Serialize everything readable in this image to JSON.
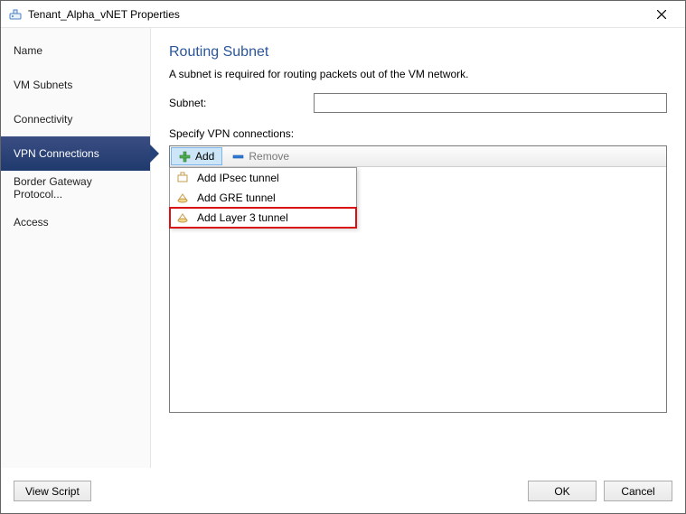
{
  "window": {
    "title": "Tenant_Alpha_vNET Properties"
  },
  "sidebar": {
    "items": [
      {
        "label": "Name",
        "selected": false
      },
      {
        "label": "VM Subnets",
        "selected": false
      },
      {
        "label": "Connectivity",
        "selected": false
      },
      {
        "label": "VPN Connections",
        "selected": true
      },
      {
        "label": "Border Gateway Protocol...",
        "selected": false
      },
      {
        "label": "Access",
        "selected": false
      }
    ]
  },
  "main": {
    "heading": "Routing Subnet",
    "description": "A subnet is required for routing packets out of the VM network.",
    "subnet_label": "Subnet:",
    "subnet_value": "",
    "vpn_label": "Specify VPN connections:",
    "toolbar": {
      "add": "Add",
      "remove": "Remove"
    },
    "dropdown": [
      {
        "label": "Add IPsec tunnel",
        "highlight": false
      },
      {
        "label": "Add GRE tunnel",
        "highlight": false
      },
      {
        "label": "Add Layer 3 tunnel",
        "highlight": true
      }
    ]
  },
  "footer": {
    "view_script": "View Script",
    "ok": "OK",
    "cancel": "Cancel"
  }
}
